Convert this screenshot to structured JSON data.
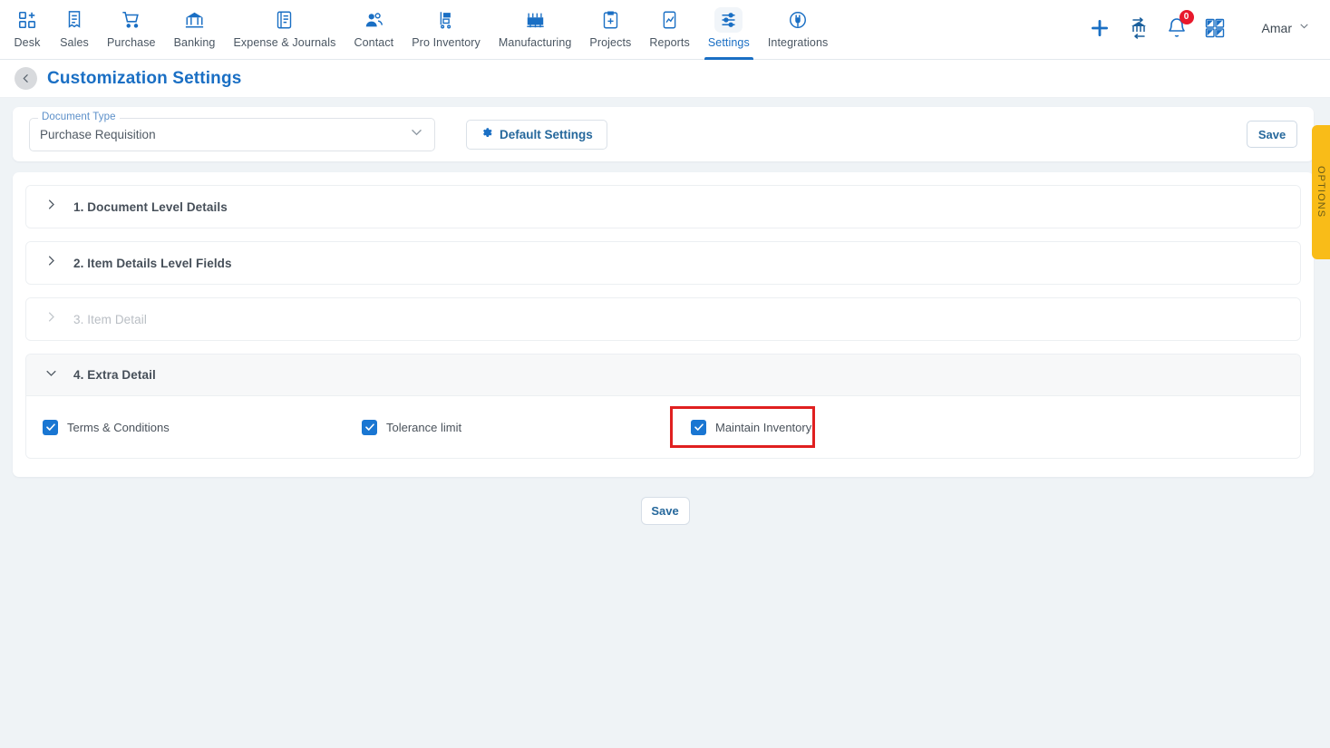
{
  "topnav": {
    "items": [
      {
        "label": "Desk",
        "icon": "desk-icon",
        "active": false
      },
      {
        "label": "Sales",
        "icon": "sales-icon",
        "active": false
      },
      {
        "label": "Purchase",
        "icon": "purchase-cart-icon",
        "active": false
      },
      {
        "label": "Banking",
        "icon": "bank-icon",
        "active": false
      },
      {
        "label": "Expense & Journals",
        "icon": "journal-icon",
        "active": false
      },
      {
        "label": "Contact",
        "icon": "contact-people-icon",
        "active": false
      },
      {
        "label": "Pro Inventory",
        "icon": "inventory-cart-icon",
        "active": false
      },
      {
        "label": "Manufacturing",
        "icon": "factory-icon",
        "active": false
      },
      {
        "label": "Projects",
        "icon": "clipboard-icon",
        "active": false
      },
      {
        "label": "Reports",
        "icon": "report-chart-icon",
        "active": false
      },
      {
        "label": "Settings",
        "icon": "sliders-icon",
        "active": true
      },
      {
        "label": "Integrations",
        "icon": "plug-icon",
        "active": false
      }
    ],
    "actions": {
      "add": "plus-icon",
      "transfer": "bank-transfer-icon",
      "notifications": "bell-icon",
      "notification_count": "0",
      "apps": "grid-apps-icon"
    },
    "user": {
      "name": "Amar",
      "caret": "chevron-down-icon"
    }
  },
  "header": {
    "back": "chevron-left-icon",
    "title": "Customization Settings"
  },
  "toolbar": {
    "document_type": {
      "label": "Document Type",
      "value": "Purchase Requisition",
      "caret": "chevron-down-icon"
    },
    "default_settings_label": "Default Settings",
    "default_settings_icon": "gear-icon",
    "save_label": "Save"
  },
  "options_tab": {
    "label": "OPTIONS"
  },
  "sections": [
    {
      "title": "1. Document Level Details",
      "expanded": false,
      "disabled": false,
      "chevron": "chevron-right-icon"
    },
    {
      "title": "2. Item Details Level Fields",
      "expanded": false,
      "disabled": false,
      "chevron": "chevron-right-icon"
    },
    {
      "title": "3. Item Detail",
      "expanded": false,
      "disabled": true,
      "chevron": "chevron-right-icon"
    },
    {
      "title": "4. Extra Detail",
      "expanded": true,
      "disabled": false,
      "chevron": "chevron-down-icon"
    }
  ],
  "extra_detail_options": [
    {
      "label": "Terms & Conditions",
      "checked": true,
      "highlighted": false
    },
    {
      "label": "Tolerance limit",
      "checked": true,
      "highlighted": false
    },
    {
      "label": "Maintain Inventory",
      "checked": true,
      "highlighted": true
    }
  ],
  "footer": {
    "save_label": "Save"
  },
  "colors": {
    "accent_blue": "#1a6fc4",
    "checkbox_blue": "#1976d2",
    "highlight_red": "#e02020",
    "options_yellow": "#f9bc18",
    "page_bg": "#eff3f6",
    "badge_red": "#e8192c"
  }
}
